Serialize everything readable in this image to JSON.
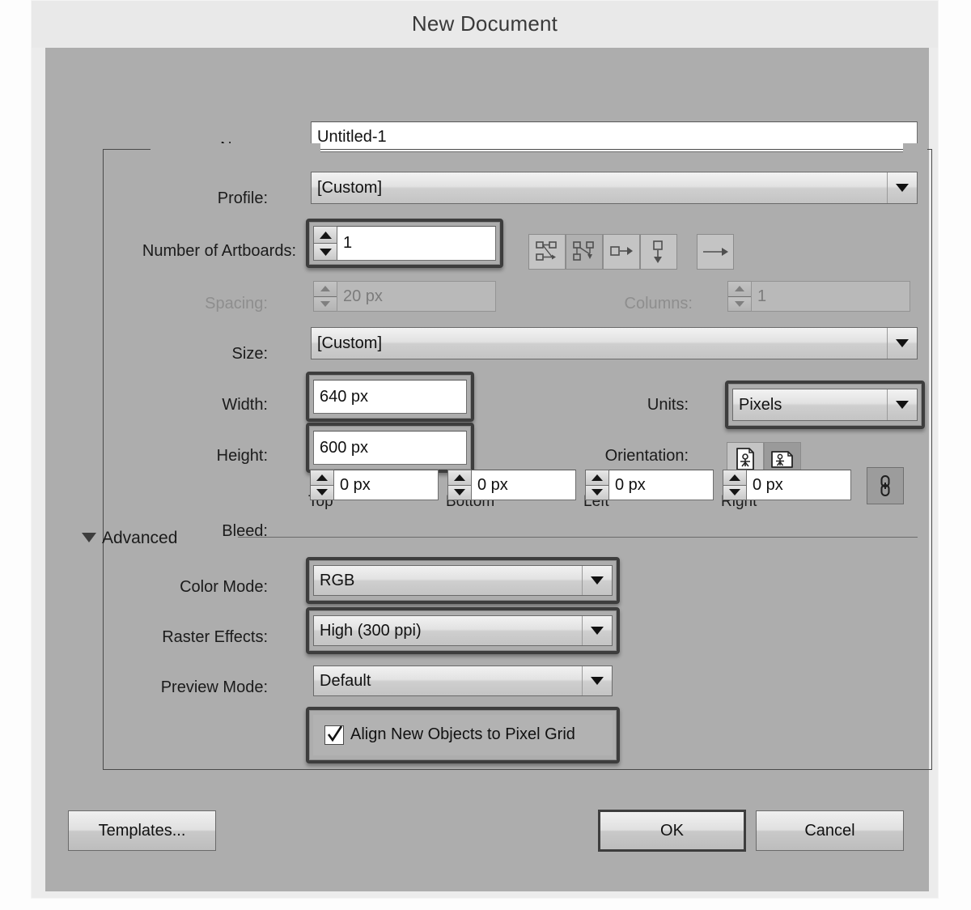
{
  "dialog": {
    "title": "New Document"
  },
  "fields": {
    "name_label": "Name:",
    "name_value": "Untitled-1",
    "profile_label": "Profile:",
    "profile_value": "[Custom]",
    "artboards_label": "Number of Artboards:",
    "artboards_value": "1",
    "spacing_label": "Spacing:",
    "spacing_value": "20 px",
    "columns_label": "Columns:",
    "columns_value": "1",
    "size_label": "Size:",
    "size_value": "[Custom]",
    "width_label": "Width:",
    "width_value": "640 px",
    "height_label": "Height:",
    "height_value": "600 px",
    "units_label": "Units:",
    "units_value": "Pixels",
    "orientation_label": "Orientation:"
  },
  "bleed": {
    "label": "Bleed:",
    "top_label": "Top",
    "bottom_label": "Bottom",
    "left_label": "Left",
    "right_label": "Right",
    "top_value": "0 px",
    "bottom_value": "0 px",
    "left_value": "0 px",
    "right_value": "0 px"
  },
  "advanced": {
    "section_label": "Advanced",
    "color_mode_label": "Color Mode:",
    "color_mode_value": "RGB",
    "raster_label": "Raster Effects:",
    "raster_value": "High (300 ppi)",
    "preview_label": "Preview Mode:",
    "preview_value": "Default",
    "align_pixel_grid_label": "Align New Objects to Pixel Grid",
    "align_pixel_grid_checked": true
  },
  "footer": {
    "templates_label": "Templates...",
    "ok_label": "OK",
    "cancel_label": "Cancel"
  },
  "icons": {
    "artboard_grid_by_row": "artboard-grid-by-row-icon",
    "artboard_grid_by_column": "artboard-grid-by-column-icon",
    "artboard_arrange_by_row": "artboard-arrange-by-row-icon",
    "artboard_arrange_by_column": "artboard-arrange-by-column-icon",
    "artboard_direction": "artboard-layout-direction-icon",
    "orientation_portrait": "orientation-portrait-icon",
    "orientation_landscape": "orientation-landscape-icon",
    "bleed_link": "bleed-link-chain-icon"
  },
  "colors": {
    "dialog_body": "#adadad",
    "titlebar": "#e9e9e9",
    "highlight_ring": "#3d3d3d",
    "field_background": "#ffffff"
  }
}
